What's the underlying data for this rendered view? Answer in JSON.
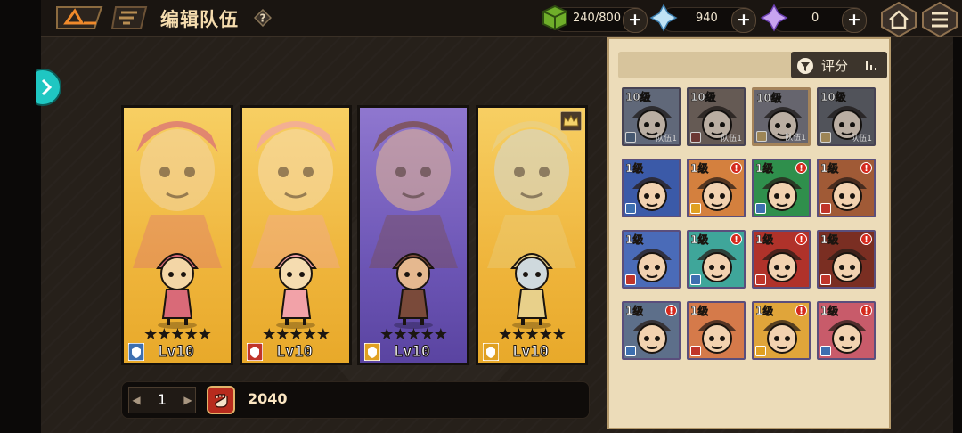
{
  "header": {
    "title": "编辑队伍",
    "energy": "240/800",
    "gems": "940",
    "crystals": "0"
  },
  "team": {
    "cards": [
      {
        "stars": "★★★★★",
        "level": "Lv10",
        "bg": "gold",
        "class_color": "#3d6fb0"
      },
      {
        "stars": "★★★★★",
        "level": "Lv10",
        "bg": "gold",
        "class_color": "#c0352a"
      },
      {
        "stars": "★★★★★",
        "level": "Lv10",
        "bg": "purple",
        "class_color": "#e0a021"
      },
      {
        "stars": "★★★★★",
        "level": "Lv10",
        "bg": "gold",
        "class_color": "#e0a021"
      }
    ],
    "page": "1",
    "power": "2040"
  },
  "roster": {
    "sort_label": "评分",
    "heroes": [
      {
        "level": "10级",
        "team": "队伍1",
        "alert": false,
        "inteam": true,
        "selected": false,
        "bg": "#6b7fae",
        "cls": "#3d6fb0"
      },
      {
        "level": "10级",
        "team": "队伍1",
        "alert": false,
        "inteam": true,
        "selected": false,
        "bg": "#8a6a5c",
        "cls": "#c0352a"
      },
      {
        "level": "10级",
        "team": "队伍1",
        "alert": false,
        "inteam": true,
        "selected": true,
        "bg": "#7d7a92",
        "cls": "#e0a021"
      },
      {
        "level": "10级",
        "team": "队伍1",
        "alert": false,
        "inteam": true,
        "selected": false,
        "bg": "#5f6578",
        "cls": "#e0a021"
      },
      {
        "level": "1级",
        "team": "",
        "alert": false,
        "inteam": false,
        "selected": false,
        "bg": "#3b5aa8",
        "cls": "#3d6fb0"
      },
      {
        "level": "1级",
        "team": "",
        "alert": true,
        "inteam": false,
        "selected": false,
        "bg": "#d4803e",
        "cls": "#e0a021"
      },
      {
        "level": "1级",
        "team": "",
        "alert": true,
        "inteam": false,
        "selected": false,
        "bg": "#2f8f4c",
        "cls": "#3d6fb0"
      },
      {
        "level": "1级",
        "team": "",
        "alert": true,
        "inteam": false,
        "selected": false,
        "bg": "#a05a36",
        "cls": "#c0352a"
      },
      {
        "level": "1级",
        "team": "",
        "alert": false,
        "inteam": false,
        "selected": false,
        "bg": "#4a6bb8",
        "cls": "#c0352a"
      },
      {
        "level": "1级",
        "team": "",
        "alert": true,
        "inteam": false,
        "selected": false,
        "bg": "#3fa69a",
        "cls": "#3d6fb0"
      },
      {
        "level": "1级",
        "team": "",
        "alert": true,
        "inteam": false,
        "selected": false,
        "bg": "#b0322a",
        "cls": "#c0352a"
      },
      {
        "level": "1级",
        "team": "",
        "alert": true,
        "inteam": false,
        "selected": false,
        "bg": "#7a2e22",
        "cls": "#c0352a"
      },
      {
        "level": "1级",
        "team": "",
        "alert": true,
        "inteam": false,
        "selected": false,
        "bg": "#5d6f8a",
        "cls": "#3d6fb0"
      },
      {
        "level": "1级",
        "team": "",
        "alert": false,
        "inteam": false,
        "selected": false,
        "bg": "#d57a4a",
        "cls": "#c0352a"
      },
      {
        "level": "1级",
        "team": "",
        "alert": true,
        "inteam": false,
        "selected": false,
        "bg": "#e0a53a",
        "cls": "#e0a021"
      },
      {
        "level": "1级",
        "team": "",
        "alert": true,
        "inteam": false,
        "selected": false,
        "bg": "#c85b6a",
        "cls": "#3d6fb0"
      }
    ]
  },
  "colors": {
    "accent_gold": "#f2c04b",
    "panel": "#ecdcb9",
    "alert_red": "#d52a1d"
  }
}
